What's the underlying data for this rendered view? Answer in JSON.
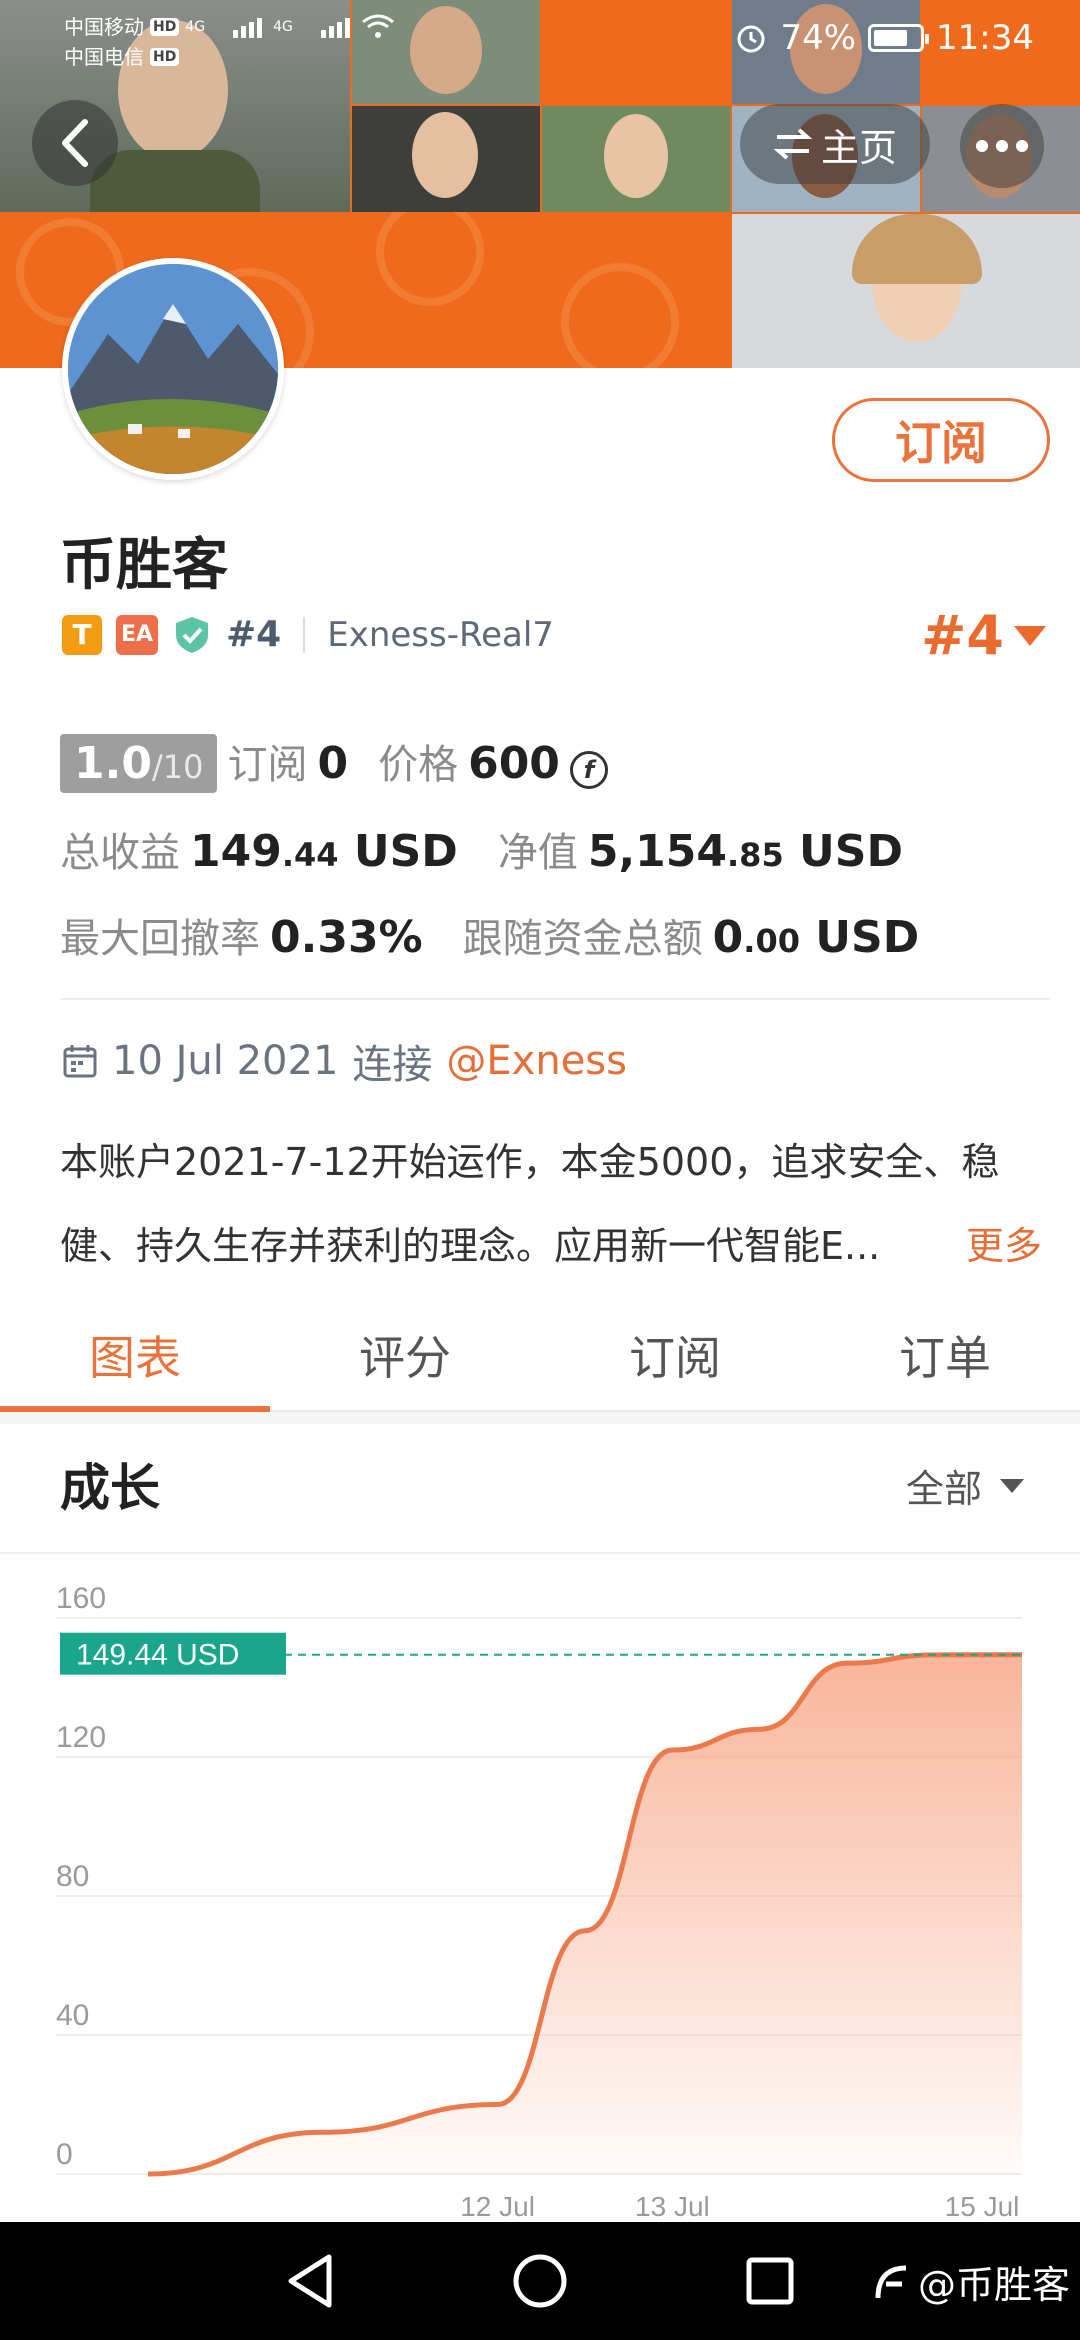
{
  "status_bar": {
    "carrier_1": "中国移动",
    "carrier_2": "中国电信",
    "hd_label": "HD",
    "network_1": "4G",
    "network_2": "4G",
    "battery": "74%",
    "battery_level": 0.74,
    "time": "11:34"
  },
  "header": {
    "home_label": "主页"
  },
  "profile": {
    "name": "币胜客",
    "badge_t": "T",
    "badge_ea": "EA",
    "rank_small": "#4",
    "broker": "Exness-Real7",
    "rank_big": "#4",
    "subscribe_label": "订阅"
  },
  "stats": {
    "score": "1.0",
    "score_max": "/10",
    "subscribe_label": "订阅",
    "subscribe_count": "0",
    "price_label": "价格",
    "price_value": "600",
    "coin_symbol": "f",
    "total_profit_label": "总收益",
    "total_profit_int": "149",
    "total_profit_dec": ".44",
    "total_profit_unit": "USD",
    "equity_label": "净值",
    "equity_int": "5,154",
    "equity_dec": ".85",
    "equity_unit": "USD",
    "drawdown_label": "最大回撤率",
    "drawdown_value": "0.33%",
    "follow_label": "跟随资金总额",
    "follow_int": "0",
    "follow_dec": ".00",
    "follow_unit": "USD"
  },
  "connection": {
    "date": "10 Jul 2021",
    "connect_label": "连接",
    "broker_link": "@Exness"
  },
  "description": {
    "line1": "本账户2021-7-12开始运作，本金5000，追求安全、稳",
    "line2": "健、持久生存并获利的理念。应用新一代智能E...",
    "more": "更多"
  },
  "tabs": [
    {
      "label": "图表"
    },
    {
      "label": "评分"
    },
    {
      "label": "订阅"
    },
    {
      "label": "订单"
    }
  ],
  "growth": {
    "title": "成长",
    "range": "全部"
  },
  "chart_data": {
    "type": "area",
    "current_label": "149.44 USD",
    "current_value": 149.44,
    "ylim": [
      0,
      160
    ],
    "yticks": [
      "0",
      "40",
      "80",
      "120",
      "160"
    ],
    "xticks": [
      "12 Jul",
      "13 Jul",
      "15 Jul"
    ],
    "series": [
      {
        "x": [
          "2021-07-10",
          "2021-07-11",
          "2021-07-12",
          "2021-07-12 12:00",
          "2021-07-13",
          "2021-07-13 12:00",
          "2021-07-14",
          "2021-07-14 12:00",
          "2021-07-15"
        ],
        "values": [
          0,
          12,
          20,
          70,
          122,
          128,
          147,
          149.4,
          149.44
        ]
      }
    ],
    "line_color": "#ea7a4c",
    "fill_color": "#f7a889",
    "label_color": "#1aa58d"
  },
  "watermark": "@币胜客"
}
